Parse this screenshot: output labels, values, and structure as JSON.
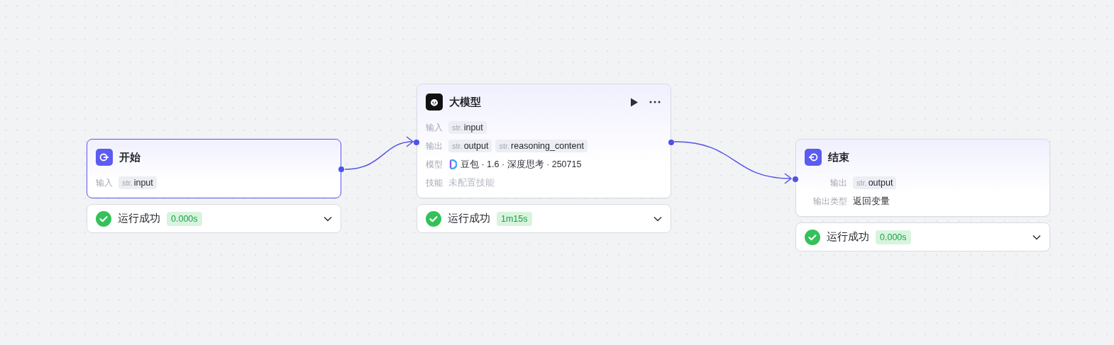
{
  "nodes": [
    {
      "kind": "start",
      "title": "开始",
      "selected": true,
      "rows": [
        {
          "label": "输入",
          "kind": "vars",
          "vars": [
            {
              "type": "str.",
              "name": "input"
            }
          ]
        }
      ],
      "status": {
        "text": "运行成功",
        "time": "0.000s"
      }
    },
    {
      "kind": "llm",
      "title": "大模型",
      "selected": false,
      "rows": [
        {
          "label": "输入",
          "kind": "vars",
          "vars": [
            {
              "type": "str.",
              "name": "input"
            }
          ]
        },
        {
          "label": "输出",
          "kind": "vars",
          "vars": [
            {
              "type": "str.",
              "name": "output"
            },
            {
              "type": "str.",
              "name": "reasoning_content"
            }
          ]
        },
        {
          "label": "模型",
          "kind": "model",
          "value": "豆包 · 1.6 · 深度思考 · 250715"
        },
        {
          "label": "技能",
          "kind": "empty",
          "value": "未配置技能"
        }
      ],
      "status": {
        "text": "运行成功",
        "time": "1m15s"
      }
    },
    {
      "kind": "end",
      "title": "结束",
      "selected": false,
      "rows": [
        {
          "label": "输出",
          "kind": "vars",
          "vars": [
            {
              "type": "str.",
              "name": "output"
            }
          ]
        },
        {
          "label": "输出类型",
          "kind": "text",
          "value": "返回变量"
        }
      ],
      "status": {
        "text": "运行成功",
        "time": "0.000s"
      }
    }
  ]
}
